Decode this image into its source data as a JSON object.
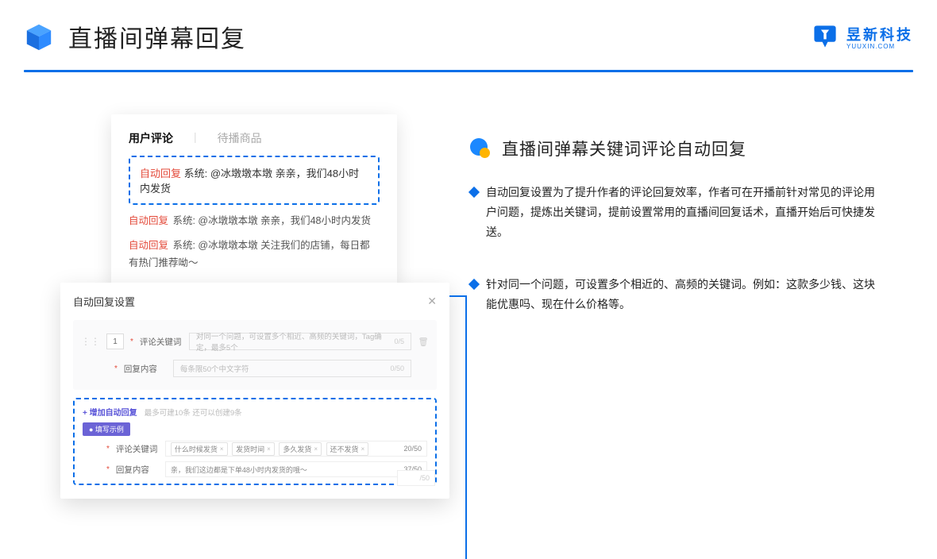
{
  "header": {
    "title": "直播间弹幕回复",
    "brand_name": "昱新科技",
    "brand_sub": "YUUXIN.COM"
  },
  "cardA": {
    "tab_active": "用户评论",
    "tab_inactive": "待播商品",
    "highlighted": "自动回复 系统: @冰墩墩本墩 亲亲，我们48小时内发货",
    "msg2": "自动回复 系统: @冰墩墩本墩 亲亲，我们48小时内发货",
    "msg3": "自动回复 系统: @冰墩墩本墩 关注我们的店铺，每日都有热门推荐呦～",
    "auto_label": "自动回复"
  },
  "cardB": {
    "title": "自动回复设置",
    "idx": "1",
    "label_keyword": "评论关键词",
    "ph_keyword": "对同一个问题，可设置多个相近、高频的关键词，Tag确定，最多5个",
    "count_kw": "0/5",
    "label_reply": "回复内容",
    "ph_reply": "每条限50个中文字符",
    "count_reply": "0/50",
    "add_link": "+ 增加自动回复",
    "add_sub": "最多可建10条 还可以创建9条",
    "pill": "● 填写示例",
    "ex_kw_label": "评论关键词",
    "tags": [
      "什么时候发货",
      "发货时间",
      "多久发货",
      "还不发货"
    ],
    "ex_kw_count": "20/50",
    "ex_reply_label": "回复内容",
    "ex_reply_val": "亲，我们这边都是下单48小时内发货的哦～",
    "ex_reply_count": "37/50",
    "stub_count": "/50"
  },
  "right": {
    "section_title": "直播间弹幕关键词评论自动回复",
    "b1": "自动回复设置为了提升作者的评论回复效率，作者可在开播前针对常见的评论用户问题，提炼出关键词，提前设置常用的直播间回复话术，直播开始后可快捷发送。",
    "b2": "针对同一个问题，可设置多个相近的、高频的关键词。例如：这款多少钱、这块能优惠吗、现在什么价格等。"
  }
}
